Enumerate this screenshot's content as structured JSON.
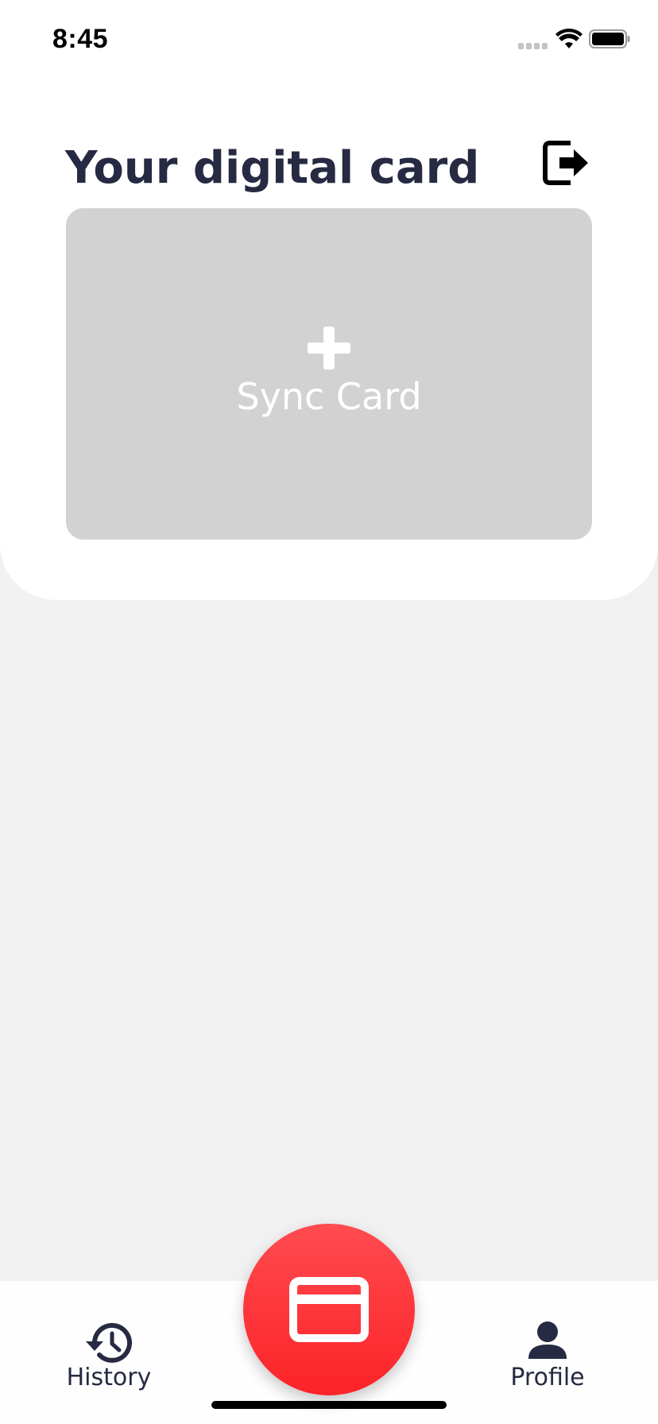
{
  "status_bar": {
    "time": "8:45"
  },
  "header": {
    "title": "Your digital card",
    "logout_icon": "logout-icon"
  },
  "card": {
    "sync_label": "Sync Card",
    "icon": "plus-icon"
  },
  "bottom_nav": {
    "items": [
      {
        "label": "History",
        "icon": "history-icon"
      },
      {
        "label": "Profile",
        "icon": "profile-icon"
      }
    ],
    "fab_icon": "credit-card-icon"
  },
  "colors": {
    "background": "#f1f1f1",
    "panel": "#ffffff",
    "title_text": "#262a42",
    "card_placeholder": "#d2d2d2",
    "accent_red": "#fc2327"
  }
}
